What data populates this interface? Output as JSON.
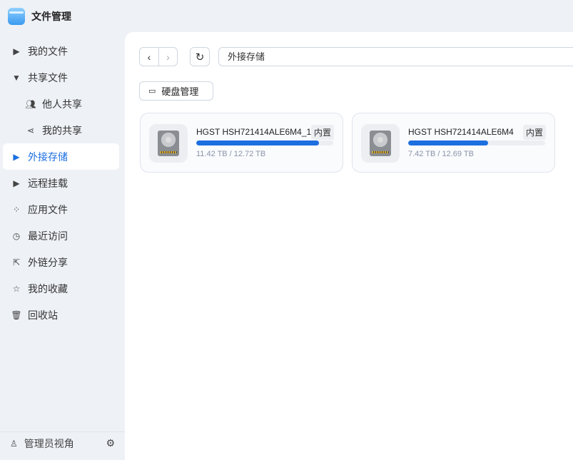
{
  "app": {
    "title": "文件管理"
  },
  "sidebar": {
    "items": [
      {
        "label": "我的文件",
        "icon": "caret-right-icon"
      },
      {
        "label": "共享文件",
        "icon": "caret-down-icon"
      },
      {
        "label": "他人共享",
        "icon": "users-icon"
      },
      {
        "label": "我的共享",
        "icon": "share-icon"
      },
      {
        "label": "外接存储",
        "icon": "caret-right-icon"
      },
      {
        "label": "远程挂载",
        "icon": "caret-right-icon"
      },
      {
        "label": "应用文件",
        "icon": "apps-icon"
      },
      {
        "label": "最近访问",
        "icon": "clock-icon"
      },
      {
        "label": "外链分享",
        "icon": "external-share-icon"
      },
      {
        "label": "我的收藏",
        "icon": "star-icon"
      },
      {
        "label": "回收站",
        "icon": "trash-icon"
      }
    ],
    "active": "外接存储",
    "bottom": {
      "label": "管理员视角"
    }
  },
  "toolbar": {
    "path": "外接存储",
    "disk_manage": "硬盘管理"
  },
  "accent": "#1d6fe0",
  "disks": [
    {
      "name": "HGST HSH721414ALE6M4_1",
      "tag": "内置",
      "size": "11.42 TB / 12.72 TB",
      "used_fraction": 0.898
    },
    {
      "name": "HGST HSH721414ALE6M4",
      "tag": "内置",
      "size": "7.42 TB / 12.69 TB",
      "used_fraction": 0.585
    }
  ]
}
